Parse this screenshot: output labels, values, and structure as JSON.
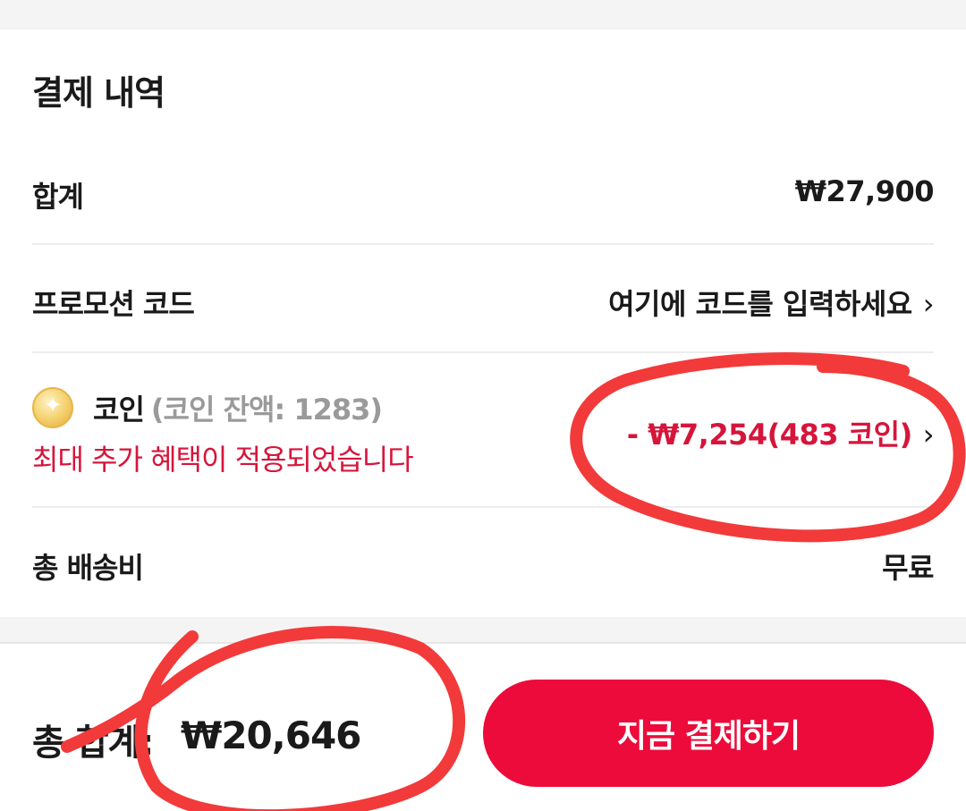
{
  "payment": {
    "title": "결제 내역",
    "subtotal": {
      "label": "합계",
      "value": "₩27,900"
    },
    "promo": {
      "label": "프로모션 코드",
      "placeholder": "여기에 코드를 입력하세요",
      "chevron": "›"
    },
    "coin": {
      "icon": "coin-icon",
      "label": "코인",
      "balance": "(코인 잔액: 1283)",
      "note": "최대 추가 혜택이 적용되었습니다",
      "discount": "- ₩7,254(483 코인)",
      "chevron": "›"
    },
    "shipping": {
      "label": "총 배송비",
      "value": "무료"
    }
  },
  "footer": {
    "total_label": "총 합계:",
    "total_value": "₩20,646",
    "pay_button": "지금 결제하기"
  },
  "colors": {
    "accent": "#ec0b3a",
    "discount_text": "#d6153b",
    "annotation_red": "#f23a3a",
    "muted_text": "#9a9a9a"
  }
}
